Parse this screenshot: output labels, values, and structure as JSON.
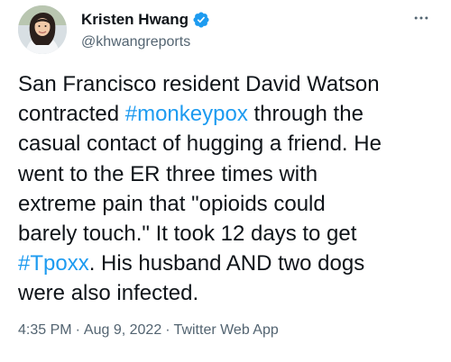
{
  "author": {
    "display_name": "Kristen Hwang",
    "handle": "@khwangreports",
    "verified_icon": "verified-badge-icon",
    "avatar_icon": "profile-photo"
  },
  "more_icon": "ellipsis-icon",
  "tweet": {
    "lines": [
      {
        "pre": "San Francisco resident David Watson",
        "tag": "",
        "post": ""
      },
      {
        "pre": "contracted ",
        "tag": "#monkeypox",
        "post": " through the"
      },
      {
        "pre": "casual contact of hugging a friend. He",
        "tag": "",
        "post": ""
      },
      {
        "pre": "went to the ER three times with",
        "tag": "",
        "post": ""
      },
      {
        "pre": "extreme pain that \"opioids could",
        "tag": "",
        "post": ""
      },
      {
        "pre": "barely touch.\" It took 12 days to get",
        "tag": "",
        "post": ""
      },
      {
        "pre": "",
        "tag": "#Tpoxx",
        "post": ". His husband AND two dogs"
      },
      {
        "pre": "were also infected.",
        "tag": "",
        "post": ""
      }
    ]
  },
  "meta": {
    "time": "4:35 PM",
    "date": "Aug 9, 2022",
    "source": "Twitter Web App",
    "separator": "·"
  },
  "colors": {
    "link": "#1d9bf0",
    "text": "#0f1419",
    "secondary": "#536471"
  }
}
